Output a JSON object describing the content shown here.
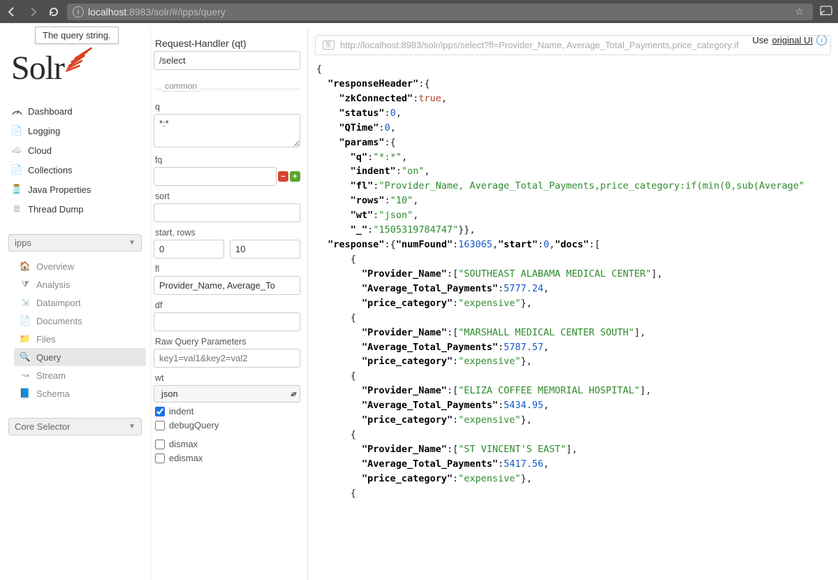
{
  "browser": {
    "url_host": "localhost",
    "url_port": ":8983",
    "url_path": "/solr/#/ipps/query",
    "tooltip": "The query string."
  },
  "topRight": {
    "prefix": "Use ",
    "link": "original UI"
  },
  "logo": {
    "text": "Solr"
  },
  "sidebar": {
    "items": [
      {
        "label": "Dashboard",
        "icon": "dashboard"
      },
      {
        "label": "Logging",
        "icon": "logging"
      },
      {
        "label": "Cloud",
        "icon": "cloud"
      },
      {
        "label": "Collections",
        "icon": "collections"
      },
      {
        "label": "Java Properties",
        "icon": "jar"
      },
      {
        "label": "Thread Dump",
        "icon": "thread"
      }
    ],
    "coreSelected": "ipps",
    "subitems": [
      {
        "label": "Overview",
        "icon": "home"
      },
      {
        "label": "Analysis",
        "icon": "funnel"
      },
      {
        "label": "Dataimport",
        "icon": "import"
      },
      {
        "label": "Documents",
        "icon": "doc"
      },
      {
        "label": "Files",
        "icon": "folder"
      },
      {
        "label": "Query",
        "icon": "search",
        "active": true
      },
      {
        "label": "Stream",
        "icon": "stream"
      },
      {
        "label": "Schema",
        "icon": "schema"
      }
    ],
    "coreSelector": "Core Selector"
  },
  "form": {
    "reqHandler": {
      "label": "Request-Handler (qt)",
      "value": "/select"
    },
    "commonLabel": "common",
    "q": {
      "label": "q",
      "value": "*:*"
    },
    "fq": {
      "label": "fq",
      "value": ""
    },
    "sort": {
      "label": "sort",
      "value": ""
    },
    "startRows": {
      "label": "start, rows",
      "start": "0",
      "rows": "10"
    },
    "fl": {
      "label": "fl",
      "value": "Provider_Name, Average_To"
    },
    "df": {
      "label": "df",
      "value": ""
    },
    "raw": {
      "label": "Raw Query Parameters",
      "placeholder": "key1=val1&key2=val2"
    },
    "wt": {
      "label": "wt",
      "value": "json"
    },
    "indent": {
      "label": "indent",
      "checked": true
    },
    "debugQuery": {
      "label": "debugQuery",
      "checked": false
    },
    "dismax": {
      "label": "dismax",
      "checked": false
    },
    "edismax": {
      "label": "edismax",
      "checked": false
    }
  },
  "resultUrl": "http://localhost:8983/solr/ipps/select?fl=Provider_Name, Average_Total_Payments,price_category:if",
  "response": {
    "zkConnected": true,
    "status": 0,
    "QTime": 0,
    "params": {
      "q": "*:*",
      "indent": "on",
      "fl": "Provider_Name, Average_Total_Payments,price_category:if(min(0,sub(Average",
      "rows": "10",
      "wt": "json",
      "_": "1505319784747"
    },
    "numFound": 163065,
    "start": 0,
    "docs": [
      {
        "Provider_Name": "SOUTHEAST ALABAMA MEDICAL CENTER",
        "Average_Total_Payments": 5777.24,
        "price_category": "expensive"
      },
      {
        "Provider_Name": "MARSHALL MEDICAL CENTER SOUTH",
        "Average_Total_Payments": 5787.57,
        "price_category": "expensive"
      },
      {
        "Provider_Name": "ELIZA COFFEE MEMORIAL HOSPITAL",
        "Average_Total_Payments": 5434.95,
        "price_category": "expensive"
      },
      {
        "Provider_Name": "ST VINCENT'S EAST",
        "Average_Total_Payments": 5417.56,
        "price_category": "expensive"
      }
    ]
  }
}
